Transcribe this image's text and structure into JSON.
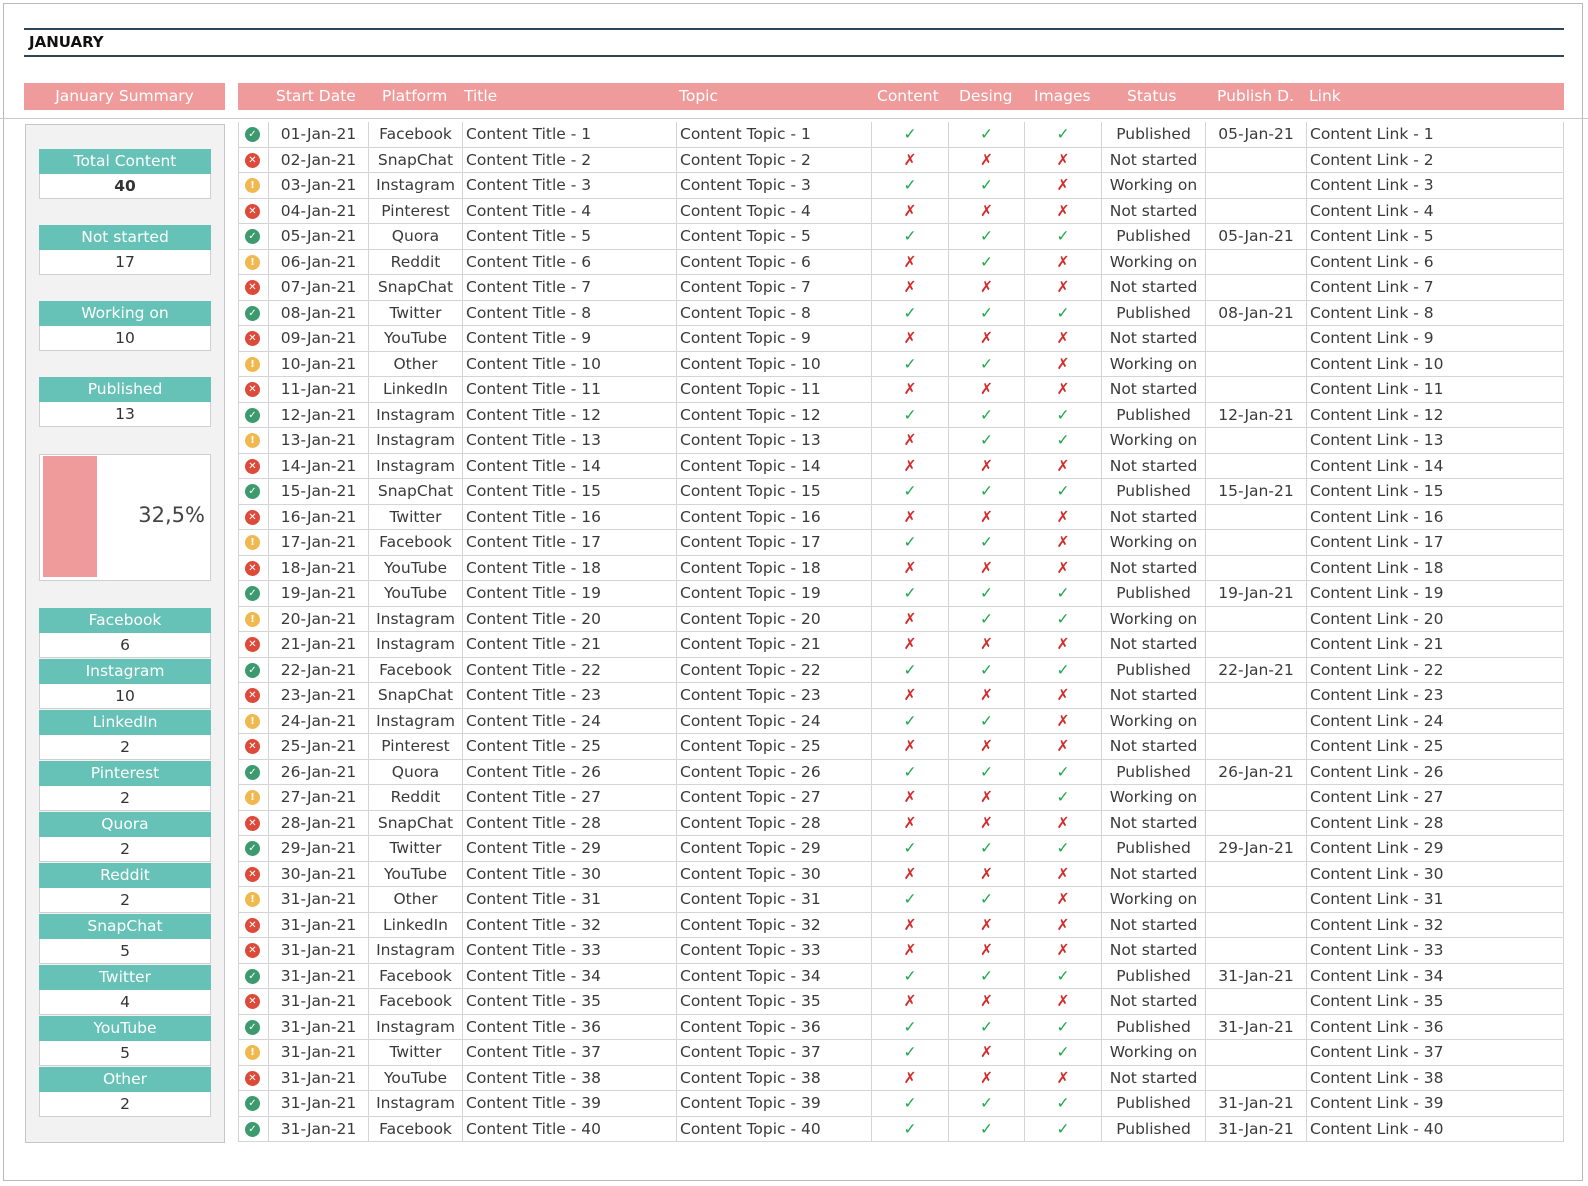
{
  "month_title": "JANUARY",
  "summary": {
    "heading": "January Summary",
    "total_label": "Total Content",
    "total_value": "40",
    "status_tiles": [
      {
        "label": "Not started",
        "value": "17"
      },
      {
        "label": "Working on",
        "value": "10"
      },
      {
        "label": "Published",
        "value": "13"
      }
    ],
    "published_percent_text": "32,5%",
    "published_fraction": 0.325,
    "bar_color": "#f09b9b",
    "platform_tiles": [
      {
        "label": "Facebook",
        "value": "6"
      },
      {
        "label": "Instagram",
        "value": "10"
      },
      {
        "label": "LinkedIn",
        "value": "2"
      },
      {
        "label": "Pinterest",
        "value": "2"
      },
      {
        "label": "Quora",
        "value": "2"
      },
      {
        "label": "Reddit",
        "value": "2"
      },
      {
        "label": "SnapChat",
        "value": "5"
      },
      {
        "label": "Twitter",
        "value": "4"
      },
      {
        "label": "YouTube",
        "value": "5"
      },
      {
        "label": "Other",
        "value": "2"
      }
    ]
  },
  "table": {
    "headers": {
      "start_date": "Start Date",
      "platform": "Platform",
      "title": "Title",
      "topic": "Topic",
      "content": "Content",
      "design": "Desing",
      "images": "Images",
      "status": "Status",
      "publish": "Publish D.",
      "link": "Link"
    },
    "colors": {
      "header_bg": "#f09b9b",
      "tile_bg": "#66c2b7",
      "check": "#22a84e",
      "cross": "#d22d2d",
      "published_icon": "#3d9a6f",
      "not_started_icon": "#dd4a3a",
      "working_icon": "#f0b94f"
    },
    "rows": [
      {
        "icon": "check-circle-icon",
        "date": "01-Jan-21",
        "platform": "Facebook",
        "title": "Content Title - 1",
        "topic": "Content Topic - 1",
        "content": "✓",
        "design": "✓",
        "images": "✓",
        "status": "Published",
        "publish": "05-Jan-21",
        "link": "Content Link - 1"
      },
      {
        "icon": "x-circle-icon",
        "date": "02-Jan-21",
        "platform": "SnapChat",
        "title": "Content Title - 2",
        "topic": "Content Topic - 2",
        "content": "✗",
        "design": "✗",
        "images": "✗",
        "status": "Not started",
        "publish": "",
        "link": "Content Link - 2"
      },
      {
        "icon": "warning-circle-icon",
        "date": "03-Jan-21",
        "platform": "Instagram",
        "title": "Content Title - 3",
        "topic": "Content Topic - 3",
        "content": "✓",
        "design": "✓",
        "images": "✗",
        "status": "Working on",
        "publish": "",
        "link": "Content Link - 3"
      },
      {
        "icon": "x-circle-icon",
        "date": "04-Jan-21",
        "platform": "Pinterest",
        "title": "Content Title - 4",
        "topic": "Content Topic - 4",
        "content": "✗",
        "design": "✗",
        "images": "✗",
        "status": "Not started",
        "publish": "",
        "link": "Content Link - 4"
      },
      {
        "icon": "check-circle-icon",
        "date": "05-Jan-21",
        "platform": "Quora",
        "title": "Content Title - 5",
        "topic": "Content Topic - 5",
        "content": "✓",
        "design": "✓",
        "images": "✓",
        "status": "Published",
        "publish": "05-Jan-21",
        "link": "Content Link - 5"
      },
      {
        "icon": "warning-circle-icon",
        "date": "06-Jan-21",
        "platform": "Reddit",
        "title": "Content Title - 6",
        "topic": "Content Topic - 6",
        "content": "✗",
        "design": "✓",
        "images": "✗",
        "status": "Working on",
        "publish": "",
        "link": "Content Link - 6"
      },
      {
        "icon": "x-circle-icon",
        "date": "07-Jan-21",
        "platform": "SnapChat",
        "title": "Content Title - 7",
        "topic": "Content Topic - 7",
        "content": "✗",
        "design": "✗",
        "images": "✗",
        "status": "Not started",
        "publish": "",
        "link": "Content Link - 7"
      },
      {
        "icon": "check-circle-icon",
        "date": "08-Jan-21",
        "platform": "Twitter",
        "title": "Content Title - 8",
        "topic": "Content Topic - 8",
        "content": "✓",
        "design": "✓",
        "images": "✓",
        "status": "Published",
        "publish": "08-Jan-21",
        "link": "Content Link - 8"
      },
      {
        "icon": "x-circle-icon",
        "date": "09-Jan-21",
        "platform": "YouTube",
        "title": "Content Title - 9",
        "topic": "Content Topic - 9",
        "content": "✗",
        "design": "✗",
        "images": "✗",
        "status": "Not started",
        "publish": "",
        "link": "Content Link - 9"
      },
      {
        "icon": "warning-circle-icon",
        "date": "10-Jan-21",
        "platform": "Other",
        "title": "Content Title - 10",
        "topic": "Content Topic - 10",
        "content": "✓",
        "design": "✓",
        "images": "✗",
        "status": "Working on",
        "publish": "",
        "link": "Content Link - 10"
      },
      {
        "icon": "x-circle-icon",
        "date": "11-Jan-21",
        "platform": "LinkedIn",
        "title": "Content Title - 11",
        "topic": "Content Topic - 11",
        "content": "✗",
        "design": "✗",
        "images": "✗",
        "status": "Not started",
        "publish": "",
        "link": "Content Link - 11"
      },
      {
        "icon": "check-circle-icon",
        "date": "12-Jan-21",
        "platform": "Instagram",
        "title": "Content Title - 12",
        "topic": "Content Topic - 12",
        "content": "✓",
        "design": "✓",
        "images": "✓",
        "status": "Published",
        "publish": "12-Jan-21",
        "link": "Content Link - 12"
      },
      {
        "icon": "warning-circle-icon",
        "date": "13-Jan-21",
        "platform": "Instagram",
        "title": "Content Title - 13",
        "topic": "Content Topic - 13",
        "content": "✗",
        "design": "✓",
        "images": "✓",
        "status": "Working on",
        "publish": "",
        "link": "Content Link - 13"
      },
      {
        "icon": "x-circle-icon",
        "date": "14-Jan-21",
        "platform": "Instagram",
        "title": "Content Title - 14",
        "topic": "Content Topic - 14",
        "content": "✗",
        "design": "✗",
        "images": "✗",
        "status": "Not started",
        "publish": "",
        "link": "Content Link - 14"
      },
      {
        "icon": "check-circle-icon",
        "date": "15-Jan-21",
        "platform": "SnapChat",
        "title": "Content Title - 15",
        "topic": "Content Topic - 15",
        "content": "✓",
        "design": "✓",
        "images": "✓",
        "status": "Published",
        "publish": "15-Jan-21",
        "link": "Content Link - 15"
      },
      {
        "icon": "x-circle-icon",
        "date": "16-Jan-21",
        "platform": "Twitter",
        "title": "Content Title - 16",
        "topic": "Content Topic - 16",
        "content": "✗",
        "design": "✗",
        "images": "✗",
        "status": "Not started",
        "publish": "",
        "link": "Content Link - 16"
      },
      {
        "icon": "warning-circle-icon",
        "date": "17-Jan-21",
        "platform": "Facebook",
        "title": "Content Title - 17",
        "topic": "Content Topic - 17",
        "content": "✓",
        "design": "✓",
        "images": "✗",
        "status": "Working on",
        "publish": "",
        "link": "Content Link - 17"
      },
      {
        "icon": "x-circle-icon",
        "date": "18-Jan-21",
        "platform": "YouTube",
        "title": "Content Title - 18",
        "topic": "Content Topic - 18",
        "content": "✗",
        "design": "✗",
        "images": "✗",
        "status": "Not started",
        "publish": "",
        "link": "Content Link - 18"
      },
      {
        "icon": "check-circle-icon",
        "date": "19-Jan-21",
        "platform": "YouTube",
        "title": "Content Title - 19",
        "topic": "Content Topic - 19",
        "content": "✓",
        "design": "✓",
        "images": "✓",
        "status": "Published",
        "publish": "19-Jan-21",
        "link": "Content Link - 19"
      },
      {
        "icon": "warning-circle-icon",
        "date": "20-Jan-21",
        "platform": "Instagram",
        "title": "Content Title - 20",
        "topic": "Content Topic - 20",
        "content": "✗",
        "design": "✓",
        "images": "✓",
        "status": "Working on",
        "publish": "",
        "link": "Content Link - 20"
      },
      {
        "icon": "x-circle-icon",
        "date": "21-Jan-21",
        "platform": "Instagram",
        "title": "Content Title - 21",
        "topic": "Content Topic - 21",
        "content": "✗",
        "design": "✗",
        "images": "✗",
        "status": "Not started",
        "publish": "",
        "link": "Content Link - 21"
      },
      {
        "icon": "check-circle-icon",
        "date": "22-Jan-21",
        "platform": "Facebook",
        "title": "Content Title - 22",
        "topic": "Content Topic - 22",
        "content": "✓",
        "design": "✓",
        "images": "✓",
        "status": "Published",
        "publish": "22-Jan-21",
        "link": "Content Link - 22"
      },
      {
        "icon": "x-circle-icon",
        "date": "23-Jan-21",
        "platform": "SnapChat",
        "title": "Content Title - 23",
        "topic": "Content Topic - 23",
        "content": "✗",
        "design": "✗",
        "images": "✗",
        "status": "Not started",
        "publish": "",
        "link": "Content Link - 23"
      },
      {
        "icon": "warning-circle-icon",
        "date": "24-Jan-21",
        "platform": "Instagram",
        "title": "Content Title - 24",
        "topic": "Content Topic - 24",
        "content": "✓",
        "design": "✓",
        "images": "✗",
        "status": "Working on",
        "publish": "",
        "link": "Content Link - 24"
      },
      {
        "icon": "x-circle-icon",
        "date": "25-Jan-21",
        "platform": "Pinterest",
        "title": "Content Title - 25",
        "topic": "Content Topic - 25",
        "content": "✗",
        "design": "✗",
        "images": "✗",
        "status": "Not started",
        "publish": "",
        "link": "Content Link - 25"
      },
      {
        "icon": "check-circle-icon",
        "date": "26-Jan-21",
        "platform": "Quora",
        "title": "Content Title - 26",
        "topic": "Content Topic - 26",
        "content": "✓",
        "design": "✓",
        "images": "✓",
        "status": "Published",
        "publish": "26-Jan-21",
        "link": "Content Link - 26"
      },
      {
        "icon": "warning-circle-icon",
        "date": "27-Jan-21",
        "platform": "Reddit",
        "title": "Content Title - 27",
        "topic": "Content Topic - 27",
        "content": "✗",
        "design": "✗",
        "images": "✓",
        "status": "Working on",
        "publish": "",
        "link": "Content Link - 27"
      },
      {
        "icon": "x-circle-icon",
        "date": "28-Jan-21",
        "platform": "SnapChat",
        "title": "Content Title - 28",
        "topic": "Content Topic - 28",
        "content": "✗",
        "design": "✗",
        "images": "✗",
        "status": "Not started",
        "publish": "",
        "link": "Content Link - 28"
      },
      {
        "icon": "check-circle-icon",
        "date": "29-Jan-21",
        "platform": "Twitter",
        "title": "Content Title - 29",
        "topic": "Content Topic - 29",
        "content": "✓",
        "design": "✓",
        "images": "✓",
        "status": "Published",
        "publish": "29-Jan-21",
        "link": "Content Link - 29"
      },
      {
        "icon": "x-circle-icon",
        "date": "30-Jan-21",
        "platform": "YouTube",
        "title": "Content Title - 30",
        "topic": "Content Topic - 30",
        "content": "✗",
        "design": "✗",
        "images": "✗",
        "status": "Not started",
        "publish": "",
        "link": "Content Link - 30"
      },
      {
        "icon": "warning-circle-icon",
        "date": "31-Jan-21",
        "platform": "Other",
        "title": "Content Title - 31",
        "topic": "Content Topic - 31",
        "content": "✓",
        "design": "✓",
        "images": "✗",
        "status": "Working on",
        "publish": "",
        "link": "Content Link - 31"
      },
      {
        "icon": "x-circle-icon",
        "date": "31-Jan-21",
        "platform": "LinkedIn",
        "title": "Content Title - 32",
        "topic": "Content Topic - 32",
        "content": "✗",
        "design": "✗",
        "images": "✗",
        "status": "Not started",
        "publish": "",
        "link": "Content Link - 32"
      },
      {
        "icon": "x-circle-icon",
        "date": "31-Jan-21",
        "platform": "Instagram",
        "title": "Content Title - 33",
        "topic": "Content Topic - 33",
        "content": "✗",
        "design": "✗",
        "images": "✗",
        "status": "Not started",
        "publish": "",
        "link": "Content Link - 33"
      },
      {
        "icon": "check-circle-icon",
        "date": "31-Jan-21",
        "platform": "Facebook",
        "title": "Content Title - 34",
        "topic": "Content Topic - 34",
        "content": "✓",
        "design": "✓",
        "images": "✓",
        "status": "Published",
        "publish": "31-Jan-21",
        "link": "Content Link - 34"
      },
      {
        "icon": "x-circle-icon",
        "date": "31-Jan-21",
        "platform": "Facebook",
        "title": "Content Title - 35",
        "topic": "Content Topic - 35",
        "content": "✗",
        "design": "✗",
        "images": "✗",
        "status": "Not started",
        "publish": "",
        "link": "Content Link - 35"
      },
      {
        "icon": "check-circle-icon",
        "date": "31-Jan-21",
        "platform": "Instagram",
        "title": "Content Title - 36",
        "topic": "Content Topic - 36",
        "content": "✓",
        "design": "✓",
        "images": "✓",
        "status": "Published",
        "publish": "31-Jan-21",
        "link": "Content Link - 36"
      },
      {
        "icon": "warning-circle-icon",
        "date": "31-Jan-21",
        "platform": "Twitter",
        "title": "Content Title - 37",
        "topic": "Content Topic - 37",
        "content": "✓",
        "design": "✗",
        "images": "✓",
        "status": "Working on",
        "publish": "",
        "link": "Content Link - 37"
      },
      {
        "icon": "x-circle-icon",
        "date": "31-Jan-21",
        "platform": "YouTube",
        "title": "Content Title - 38",
        "topic": "Content Topic - 38",
        "content": "✗",
        "design": "✗",
        "images": "✗",
        "status": "Not started",
        "publish": "",
        "link": "Content Link - 38"
      },
      {
        "icon": "check-circle-icon",
        "date": "31-Jan-21",
        "platform": "Instagram",
        "title": "Content Title - 39",
        "topic": "Content Topic - 39",
        "content": "✓",
        "design": "✓",
        "images": "✓",
        "status": "Published",
        "publish": "31-Jan-21",
        "link": "Content Link - 39"
      },
      {
        "icon": "check-circle-icon",
        "date": "31-Jan-21",
        "platform": "Facebook",
        "title": "Content Title - 40",
        "topic": "Content Topic - 40",
        "content": "✓",
        "design": "✓",
        "images": "✓",
        "status": "Published",
        "publish": "31-Jan-21",
        "link": "Content Link - 40"
      }
    ]
  }
}
